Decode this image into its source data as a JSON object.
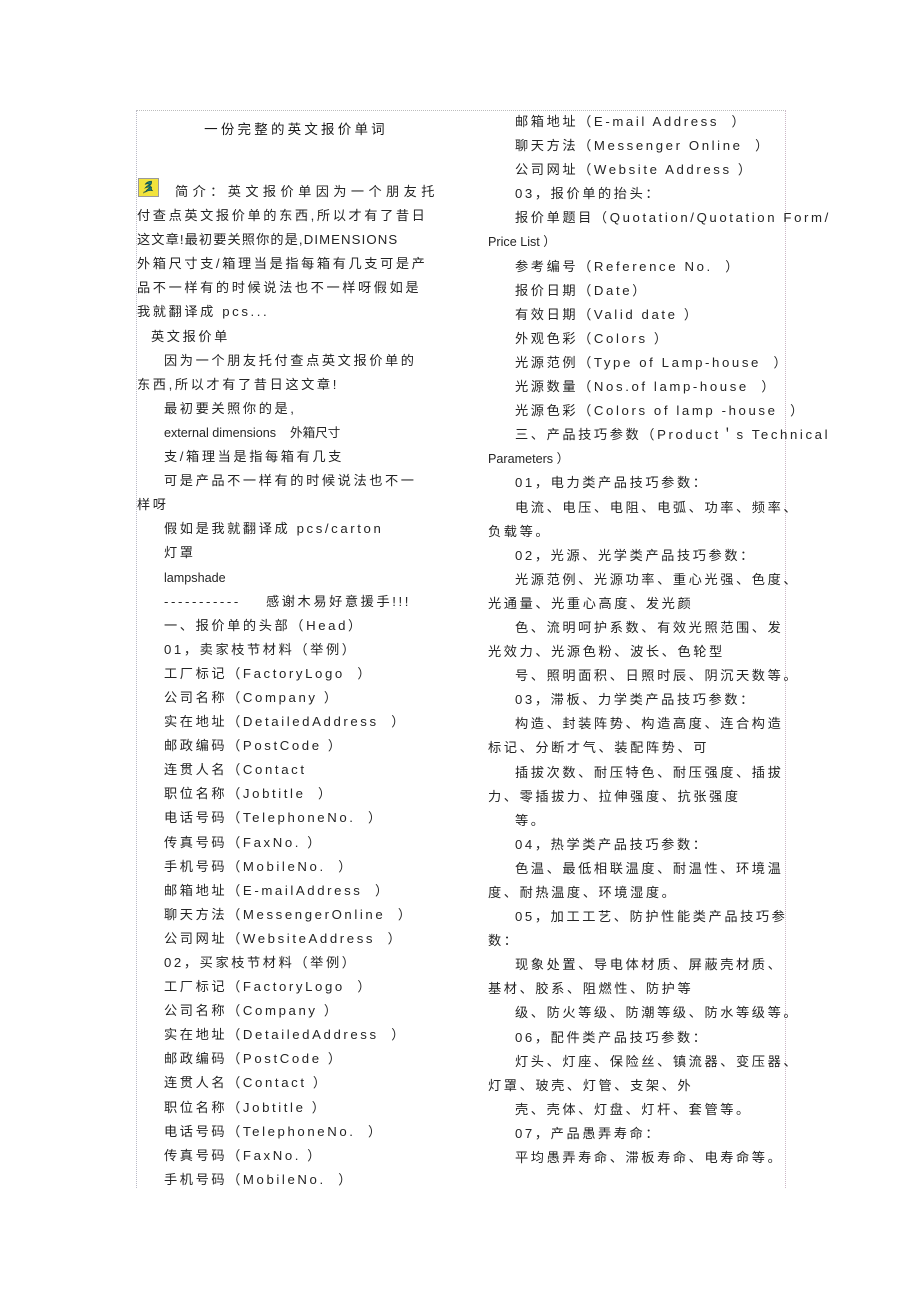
{
  "document": {
    "title": "一份完整的英文报价单词",
    "icon": {
      "name": "yellow-anchor-icon",
      "bg": "#f2e33c",
      "glyph": "#1f7a73"
    }
  },
  "left_column": {
    "lines": [
      {
        "id": "l01",
        "text": "简介：英文报价单因为一个朋友托",
        "style": "cjk-wide",
        "indent": "first"
      },
      {
        "id": "l02",
        "text": "付查点英文报价单的东西,所以才有了昔日",
        "style": "cjk",
        "indent": "0"
      },
      {
        "id": "l03",
        "text": "这文章!最初要关照你的是,DIMENSIONS",
        "style": "cjk-tight",
        "indent": "0"
      },
      {
        "id": "l04",
        "text": "外箱尺寸支/箱理当是指每箱有几支可是产",
        "style": "cjk",
        "indent": "0"
      },
      {
        "id": "l05",
        "text": "品不一样有的时候说法也不一样呀假如是",
        "style": "cjk",
        "indent": "0"
      },
      {
        "id": "l06",
        "text": "我就翻译成 pcs...",
        "style": "cjk",
        "indent": "0"
      },
      {
        "id": "l07",
        "text": "英文报价单",
        "style": "cjk",
        "indent": "1"
      },
      {
        "id": "l08",
        "text": "因为一个朋友托付查点英文报价单的",
        "style": "cjk",
        "indent": "2"
      },
      {
        "id": "l09",
        "text": "东西,所以才有了昔日这文章!",
        "style": "cjk",
        "indent": "0"
      },
      {
        "id": "l10",
        "text": "最初要关照你的是,",
        "style": "cjk",
        "indent": "2"
      },
      {
        "id": "l11",
        "text": "external dimensions    外箱尺寸",
        "style": "lat",
        "indent": "2"
      },
      {
        "id": "l12",
        "text": "支/箱理当是指每箱有几支",
        "style": "cjk",
        "indent": "2"
      },
      {
        "id": "l13",
        "text": "可是产品不一样有的时候说法也不一",
        "style": "cjk",
        "indent": "2"
      },
      {
        "id": "l14",
        "text": "样呀",
        "style": "cjk",
        "indent": "0"
      },
      {
        "id": "l15",
        "text": "假如是我就翻译成 pcs/carton",
        "style": "cjk",
        "indent": "2"
      },
      {
        "id": "l16",
        "text": "灯罩",
        "style": "cjk",
        "indent": "2"
      },
      {
        "id": "l17",
        "text": "lampshade",
        "style": "lat",
        "indent": "2"
      },
      {
        "id": "l18",
        "text": "-----------    感谢木易好意援手!!!",
        "style": "cjk",
        "indent": "2"
      },
      {
        "id": "l19",
        "text": "一、报价单的头部（Head）",
        "style": "cjk",
        "indent": "2"
      },
      {
        "id": "l20",
        "text": "01，卖家枝节材料（举例）",
        "style": "cjk",
        "indent": "2"
      },
      {
        "id": "l21",
        "text": "工厂标记（FactoryLogo  ）",
        "style": "cjk",
        "indent": "2"
      },
      {
        "id": "l22",
        "text": "公司名称（Company ）",
        "style": "cjk",
        "indent": "2"
      },
      {
        "id": "l23",
        "text": "实在地址（DetailedAddress  ）",
        "style": "cjk",
        "indent": "2"
      },
      {
        "id": "l24",
        "text": "邮政编码（PostCode ）",
        "style": "cjk",
        "indent": "2"
      },
      {
        "id": "l25",
        "text": "连贯人名（Contact",
        "style": "cjk",
        "indent": "2"
      },
      {
        "id": "l26",
        "text": "职位名称（Jobtitle  ）",
        "style": "cjk",
        "indent": "2"
      },
      {
        "id": "l27",
        "text": "电话号码（TelephoneNo.  ）",
        "style": "cjk",
        "indent": "2"
      },
      {
        "id": "l28",
        "text": "传真号码（FaxNo. ）",
        "style": "cjk",
        "indent": "2"
      },
      {
        "id": "l29",
        "text": "手机号码（MobileNo.  ）",
        "style": "cjk",
        "indent": "2"
      },
      {
        "id": "l30",
        "text": "邮箱地址（E-mailAddress  ）",
        "style": "cjk",
        "indent": "2"
      },
      {
        "id": "l31",
        "text": "聊天方法（MessengerOnline  ）",
        "style": "cjk",
        "indent": "2"
      },
      {
        "id": "l32",
        "text": "公司网址（WebsiteAddress  ）",
        "style": "cjk",
        "indent": "2"
      },
      {
        "id": "l33",
        "text": "02，买家枝节材料（举例）",
        "style": "cjk",
        "indent": "2"
      },
      {
        "id": "l34",
        "text": "工厂标记（FactoryLogo  ）",
        "style": "cjk",
        "indent": "2"
      },
      {
        "id": "l35",
        "text": "公司名称（Company ）",
        "style": "cjk",
        "indent": "2"
      },
      {
        "id": "l36",
        "text": "实在地址（DetailedAddress  ）",
        "style": "cjk",
        "indent": "2"
      },
      {
        "id": "l37",
        "text": "邮政编码（PostCode ）",
        "style": "cjk",
        "indent": "2"
      },
      {
        "id": "l38",
        "text": "连贯人名（Contact ）",
        "style": "cjk",
        "indent": "2"
      },
      {
        "id": "l39",
        "text": "职位名称（Jobtitle ）",
        "style": "cjk",
        "indent": "2"
      },
      {
        "id": "l40",
        "text": "电话号码（TelephoneNo.  ）",
        "style": "cjk",
        "indent": "2"
      },
      {
        "id": "l41",
        "text": "传真号码（FaxNo. ）",
        "style": "cjk",
        "indent": "2"
      },
      {
        "id": "l42",
        "text": "手机号码（MobileNo.  ）",
        "style": "cjk",
        "indent": "2"
      }
    ]
  },
  "right_column": {
    "lines": [
      {
        "id": "r01",
        "text": "邮箱地址（E-mail Address  ）",
        "style": "cjk",
        "indent": "2"
      },
      {
        "id": "r02",
        "text": "聊天方法（Messenger Online  ）",
        "style": "cjk",
        "indent": "2"
      },
      {
        "id": "r03",
        "text": "公司网址（Website Address ）",
        "style": "cjk",
        "indent": "2"
      },
      {
        "id": "r04",
        "text": "03，报价单的抬头：",
        "style": "cjk",
        "indent": "2"
      },
      {
        "id": "r05",
        "text": "报价单题目（Quotation/Quotation Form/",
        "style": "cjk",
        "indent": "2"
      },
      {
        "id": "r06",
        "text": "Price List ）",
        "style": "lat",
        "indent": "0"
      },
      {
        "id": "r07",
        "text": "参考编号（Reference No.  ）",
        "style": "cjk",
        "indent": "2"
      },
      {
        "id": "r08",
        "text": "报价日期（Date）",
        "style": "cjk",
        "indent": "2"
      },
      {
        "id": "r09",
        "text": "有效日期（Valid date ）",
        "style": "cjk",
        "indent": "2"
      },
      {
        "id": "r10",
        "text": "外观色彩（Colors ）",
        "style": "cjk",
        "indent": "2"
      },
      {
        "id": "r11",
        "text": "光源范例（Type of Lamp-house  ）",
        "style": "cjk",
        "indent": "2"
      },
      {
        "id": "r12",
        "text": "光源数量（Nos.of lamp-house  ）",
        "style": "cjk",
        "indent": "2"
      },
      {
        "id": "r13",
        "text": "光源色彩（Colors of lamp -house  ）",
        "style": "cjk",
        "indent": "2"
      },
      {
        "id": "r14",
        "text": "三、产品技巧参数（Product＇s Technical",
        "style": "cjk",
        "indent": "2"
      },
      {
        "id": "r15",
        "text": "Parameters ）",
        "style": "lat",
        "indent": "0"
      },
      {
        "id": "r16",
        "text": "01，电力类产品技巧参数：",
        "style": "cjk",
        "indent": "2"
      },
      {
        "id": "r17",
        "text": "电流、电压、电阻、电弧、功率、频率、",
        "style": "cjk",
        "indent": "2"
      },
      {
        "id": "r18",
        "text": "负载等。",
        "style": "cjk",
        "indent": "0"
      },
      {
        "id": "r19",
        "text": "02，光源、光学类产品技巧参数：",
        "style": "cjk",
        "indent": "2"
      },
      {
        "id": "r20",
        "text": "光源范例、光源功率、重心光强、色度、",
        "style": "cjk",
        "indent": "2"
      },
      {
        "id": "r21",
        "text": "光通量、光重心高度、发光颜",
        "style": "cjk",
        "indent": "0"
      },
      {
        "id": "r22",
        "text": "色、流明呵护系数、有效光照范围、发",
        "style": "cjk",
        "indent": "2"
      },
      {
        "id": "r23",
        "text": "光效力、光源色粉、波长、色轮型",
        "style": "cjk",
        "indent": "0"
      },
      {
        "id": "r24",
        "text": "号、照明面积、日照时辰、阴沉天数等。",
        "style": "cjk",
        "indent": "2"
      },
      {
        "id": "r25",
        "text": "03，滞板、力学类产品技巧参数：",
        "style": "cjk",
        "indent": "2"
      },
      {
        "id": "r26",
        "text": "构造、封装阵势、构造高度、连合构造",
        "style": "cjk",
        "indent": "2"
      },
      {
        "id": "r27",
        "text": "标记、分断才气、装配阵势、可",
        "style": "cjk",
        "indent": "0"
      },
      {
        "id": "r28",
        "text": "插拔次数、耐压特色、耐压强度、插拔",
        "style": "cjk",
        "indent": "2"
      },
      {
        "id": "r29",
        "text": "力、零插拔力、拉伸强度、抗张强度",
        "style": "cjk",
        "indent": "0"
      },
      {
        "id": "r30",
        "text": "等。",
        "style": "cjk",
        "indent": "2"
      },
      {
        "id": "r31",
        "text": "04，热学类产品技巧参数：",
        "style": "cjk",
        "indent": "2"
      },
      {
        "id": "r32",
        "text": "色温、最低相联温度、耐温性、环境温",
        "style": "cjk",
        "indent": "2"
      },
      {
        "id": "r33",
        "text": "度、耐热温度、环境湿度。",
        "style": "cjk",
        "indent": "0"
      },
      {
        "id": "r34",
        "text": "05，加工工艺、防护性能类产品技巧参",
        "style": "cjk",
        "indent": "2"
      },
      {
        "id": "r35",
        "text": "数：",
        "style": "cjk",
        "indent": "0"
      },
      {
        "id": "r36",
        "text": "现象处置、导电体材质、屏蔽壳材质、",
        "style": "cjk",
        "indent": "2"
      },
      {
        "id": "r37",
        "text": "基材、胶系、阻燃性、防护等",
        "style": "cjk",
        "indent": "0"
      },
      {
        "id": "r38",
        "text": "级、防火等级、防潮等级、防水等级等。",
        "style": "cjk",
        "indent": "2"
      },
      {
        "id": "r39",
        "text": "06，配件类产品技巧参数：",
        "style": "cjk",
        "indent": "2"
      },
      {
        "id": "r40",
        "text": "灯头、灯座、保险丝、镇流器、变压器、",
        "style": "cjk",
        "indent": "2"
      },
      {
        "id": "r41",
        "text": "灯罩、玻壳、灯管、支架、外",
        "style": "cjk",
        "indent": "0"
      },
      {
        "id": "r42",
        "text": "壳、壳体、灯盘、灯杆、套管等。",
        "style": "cjk",
        "indent": "2"
      },
      {
        "id": "r43",
        "text": "07，产品愚弄寿命：",
        "style": "cjk",
        "indent": "2"
      },
      {
        "id": "r44",
        "text": "平均愚弄寿命、滞板寿命、电寿命等。",
        "style": "cjk",
        "indent": "2"
      }
    ]
  }
}
